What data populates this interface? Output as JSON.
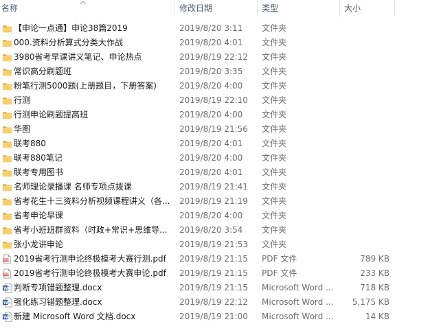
{
  "header": {
    "name": "名称",
    "date": "修改日期",
    "type": "类型",
    "size": "大小"
  },
  "colors": {
    "folder": "#f4c55a",
    "header_text": "#4c607a",
    "detail_text": "#6d6d6d",
    "word_blue": "#2b579a",
    "pdf_red": "#c0392b"
  },
  "files": [
    {
      "icon": "folder-icon",
      "name": "【申论一点通】申论38篇2019",
      "date": "2019/8/20 3:11",
      "type": "文件夹",
      "size": ""
    },
    {
      "icon": "folder-icon",
      "name": "000.资料分析算式分类大作战",
      "date": "2019/8/20 4:01",
      "type": "文件夹",
      "size": ""
    },
    {
      "icon": "folder-icon",
      "name": "3980省考早课讲义笔记、申论热点",
      "date": "2019/8/19 22:12",
      "type": "文件夹",
      "size": ""
    },
    {
      "icon": "folder-icon",
      "name": "常识高分刷题班",
      "date": "2019/8/20 3:35",
      "type": "文件夹",
      "size": ""
    },
    {
      "icon": "folder-icon",
      "name": "粉笔行测5000题(上册题目，下册答案)",
      "date": "2019/8/20 4:00",
      "type": "文件夹",
      "size": ""
    },
    {
      "icon": "folder-icon",
      "name": "行测",
      "date": "2019/8/19 22:10",
      "type": "文件夹",
      "size": ""
    },
    {
      "icon": "folder-icon",
      "name": "行测申论刷题提高班",
      "date": "2019/8/20 4:00",
      "type": "文件夹",
      "size": ""
    },
    {
      "icon": "folder-icon",
      "name": "华图",
      "date": "2019/8/19 21:56",
      "type": "文件夹",
      "size": ""
    },
    {
      "icon": "folder-icon",
      "name": "联考880",
      "date": "2019/8/20 4:01",
      "type": "文件夹",
      "size": ""
    },
    {
      "icon": "folder-icon",
      "name": "联考880笔记",
      "date": "2019/8/20 4:00",
      "type": "文件夹",
      "size": ""
    },
    {
      "icon": "folder-icon",
      "name": "联考专用图书",
      "date": "2019/8/20 4:01",
      "type": "文件夹",
      "size": ""
    },
    {
      "icon": "folder-icon",
      "name": "名师理论录播课  名师专项点拨课",
      "date": "2019/8/19 21:41",
      "type": "文件夹",
      "size": ""
    },
    {
      "icon": "folder-icon",
      "name": "省考花生十三资料分析视频课程讲义（各...",
      "date": "2019/8/19 21:19",
      "type": "文件夹",
      "size": ""
    },
    {
      "icon": "folder-icon",
      "name": "省考申论早课",
      "date": "2019/8/20 4:00",
      "type": "文件夹",
      "size": ""
    },
    {
      "icon": "folder-icon",
      "name": "省考小班班群资料（时政+常识+思维导...",
      "date": "2019/8/20 3:54",
      "type": "文件夹",
      "size": ""
    },
    {
      "icon": "folder-icon",
      "name": "张小龙讲申论",
      "date": "2019/8/19 21:53",
      "type": "文件夹",
      "size": ""
    },
    {
      "icon": "pdf-icon",
      "name": "2019省考行测申论终极模考大赛行测.pdf",
      "date": "2019/8/19 21:15",
      "type": "PDF 文件",
      "size": "789 KB"
    },
    {
      "icon": "pdf-icon",
      "name": "2019省考行测申论终极模考大赛申论.pdf",
      "date": "2019/8/19 21:15",
      "type": "PDF 文件",
      "size": "233 KB"
    },
    {
      "icon": "word-icon",
      "name": "判断专项错题整理.docx",
      "date": "2019/8/19 21:15",
      "type": "Microsoft Word ...",
      "size": "718 KB"
    },
    {
      "icon": "word-icon",
      "name": "强化练习错题整理.docx",
      "date": "2019/8/19 22:12",
      "type": "Microsoft Word ...",
      "size": "5,175 KB"
    },
    {
      "icon": "word-icon",
      "name": "新建 Microsoft Word 文档.docx",
      "date": "2019/8/19 21:00",
      "type": "Microsoft Word ...",
      "size": "14 KB"
    }
  ]
}
